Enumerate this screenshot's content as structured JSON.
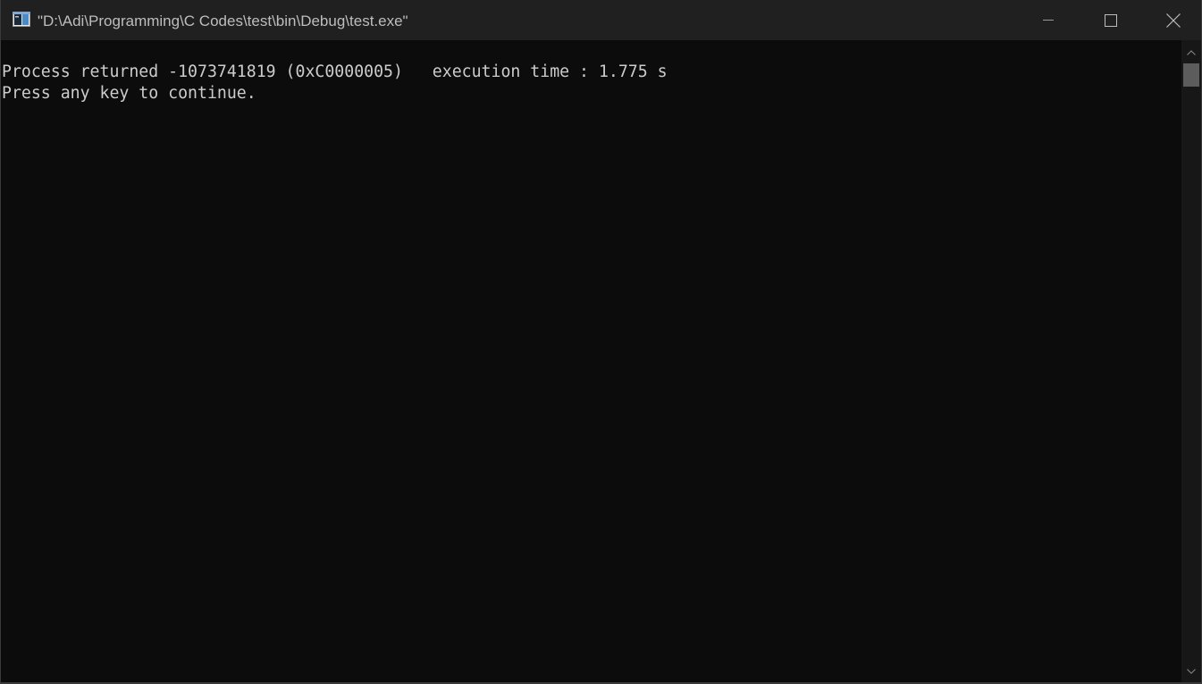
{
  "window": {
    "title": "\"D:\\Adi\\Programming\\C Codes\\test\\bin\\Debug\\test.exe\"",
    "icon": "console-app-icon",
    "controls": {
      "minimize_icon": "minimize-icon",
      "maximize_icon": "maximize-icon",
      "close_icon": "close-icon"
    }
  },
  "console": {
    "lines": [
      "Process returned -1073741819 (0xC0000005)   execution time : 1.775 s",
      "Press any key to continue."
    ],
    "text_color": "#cccccc",
    "background_color": "#0c0c0c"
  },
  "scrollbar": {
    "up_icon": "scroll-up-arrow-icon",
    "down_icon": "scroll-down-arrow-icon"
  }
}
